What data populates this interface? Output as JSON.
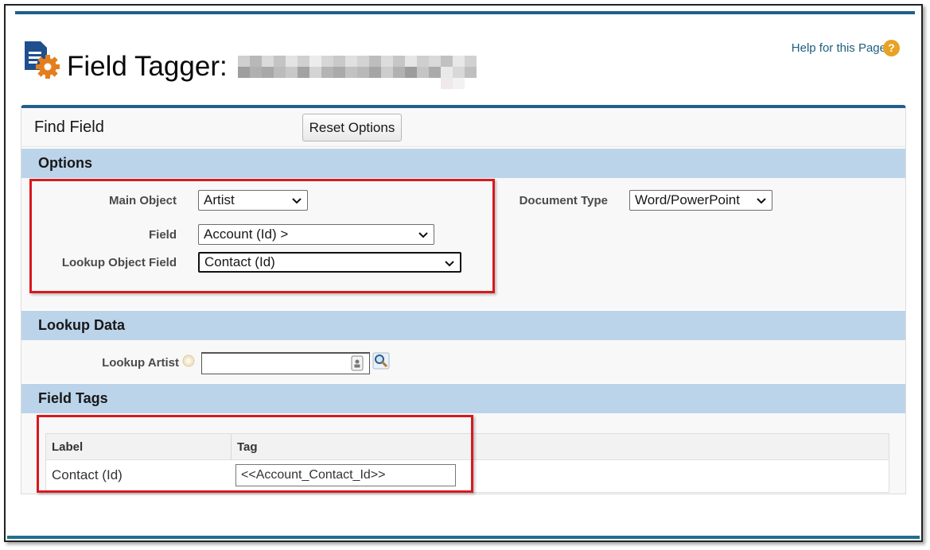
{
  "header": {
    "title": "Field Tagger:",
    "help_link": "Help for this Page",
    "help_icon": "question-icon",
    "page_icon": "document-gear-icon"
  },
  "panel": {
    "title": "Find Field",
    "reset_button": "Reset Options"
  },
  "options": {
    "section_label": "Options",
    "main_object_label": "Main Object",
    "main_object_value": "Artist",
    "field_label": "Field",
    "field_value": "Account (Id) >",
    "lookup_object_field_label": "Lookup Object Field",
    "lookup_object_field_value": "Contact (Id)",
    "document_type_label": "Document Type",
    "document_type_value": "Word/PowerPoint"
  },
  "lookup_data": {
    "section_label": "Lookup Data",
    "lookup_artist_label": "Lookup Artist",
    "lookup_artist_value": "",
    "info_icon": "info-icon",
    "lookup_icon": "magnifier-icon"
  },
  "field_tags": {
    "section_label": "Field Tags",
    "columns": [
      "Label",
      "Tag"
    ],
    "rows": [
      {
        "label": "Contact (Id)",
        "tag": "<<Account_Contact_Id>>"
      }
    ]
  },
  "colors": {
    "section_band": "#bcd4ea",
    "accent": "#1f5f8b",
    "highlight": "#d8191f",
    "help_icon": "#e8a224"
  }
}
